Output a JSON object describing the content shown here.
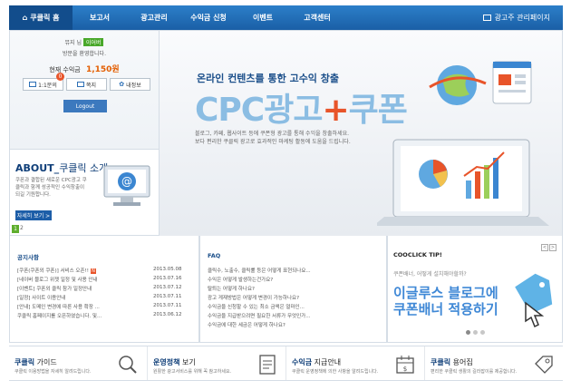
{
  "nav": {
    "home": "쿠클릭 홈",
    "items": [
      "보고서",
      "광고관리",
      "수익금 신청",
      "이벤트",
      "고객센터"
    ],
    "admin": "광고주 관리페이지"
  },
  "login": {
    "line1_prefix": "뮤지 님",
    "line1_tag": "이어버",
    "line2": "방문을 환영합니다.",
    "earnings_label": "현재 수익금",
    "earnings_value": "1,150원",
    "buttons": [
      "1:1문의",
      "쪽지",
      "내정보"
    ],
    "badge": "0",
    "logout": "Logout"
  },
  "about": {
    "title_bold": "ABOUT_",
    "title_rest": "쿠클릭 소개",
    "desc": "쿠폰과 결합된 새로운 CPC광고 쿠클릭과 함께 성공적인 수익창출이 되길 기원합니다.",
    "more": "자세히 보기 >",
    "page_active": "1",
    "page_next": "2"
  },
  "hero": {
    "subtitle": "온라인 컨텐츠를 통한 고수익 창출",
    "big_a": "CPC광고",
    "big_plus": "+",
    "big_b": "쿠폰",
    "desc1": "블로그, 카페, 웹사이트 등에 쿠폰형 광고를 통해 수익을 창출하세요.",
    "desc2": "보다 편리한 쿠클릭 광고로 효과적인 마케팅 활동에 도움을 드립니다."
  },
  "notice": {
    "title": "공지사항",
    "rows": [
      {
        "text": "[쿠폰(쿠폰외 쿠폰)] 서비스 오픈!!",
        "date": "2013.05.08",
        "new": "N"
      },
      {
        "text": "[네이버 블로그 위젯 일정 및 사용 안내",
        "date": "2013.07.16",
        "new": ""
      },
      {
        "text": "[이벤트] 쿠폰외 클릭 참가 일정안내",
        "date": "2013.07.12",
        "new": ""
      },
      {
        "text": "[일정] 사이트 이용안내",
        "date": "2013.07.11",
        "new": ""
      },
      {
        "text": "[안내] 도메인 변경에 따른 사용 확장 ...",
        "date": "2013.07.11",
        "new": ""
      },
      {
        "text": "쿠클릭 홈페이지를 오픈하였습니다. 및...",
        "date": "2013.06.12",
        "new": ""
      }
    ]
  },
  "faq": {
    "title": "FAQ",
    "rows": [
      "클릭수, 노출수, 클릭률 등은 어떻게 표현되나요...",
      "수익은 어떻게 발생하는건가요?",
      "탈퇴는 어떻게 하나요?",
      "광고 게재방법은 어떻게 변경이 가능하나요?",
      "수익금을 신청할 수 있는 최소 금액은 얼마인...",
      "수익금을 지급받으려면 필요한 서류가 무엇인가...",
      "수익금에 대한 세금은 어떻게 하나요?"
    ]
  },
  "tip": {
    "title": "COOCLICK TIP!",
    "question": "쿠폰배너, 어떻게 설치해야할까?",
    "line1": "이글루스 블로그에",
    "line2": "쿠폰배너 적용하기",
    "arrow_prev": "<",
    "arrow_next": ">"
  },
  "guides": [
    {
      "bold": "쿠클릭",
      "rest": " 가이드",
      "desc": "쿠클릭 이용방법을 자세히 알려드립니다.",
      "icon": "magnifier-icon"
    },
    {
      "bold": "운영정책",
      "rest": " 보기",
      "desc": "원활한 광고서비스를 위해 꼭 참고하세요.",
      "icon": "document-icon"
    },
    {
      "bold": "수익금",
      "rest": " 지급안내",
      "desc": "쿠클릭 운영정책에 의한 사항을 알려드립니다.",
      "icon": "calendar-icon"
    },
    {
      "bold": "쿠클릭",
      "rest": " 용어집",
      "desc": "편리한 쿠클릭 생활의 길라잡이를 제공합니다.",
      "icon": "tag-icon"
    }
  ],
  "colors": {
    "nav": "#1a5fa6",
    "accent": "#e8542a",
    "green": "#49a82a",
    "hero_text": "#8bbde3"
  }
}
